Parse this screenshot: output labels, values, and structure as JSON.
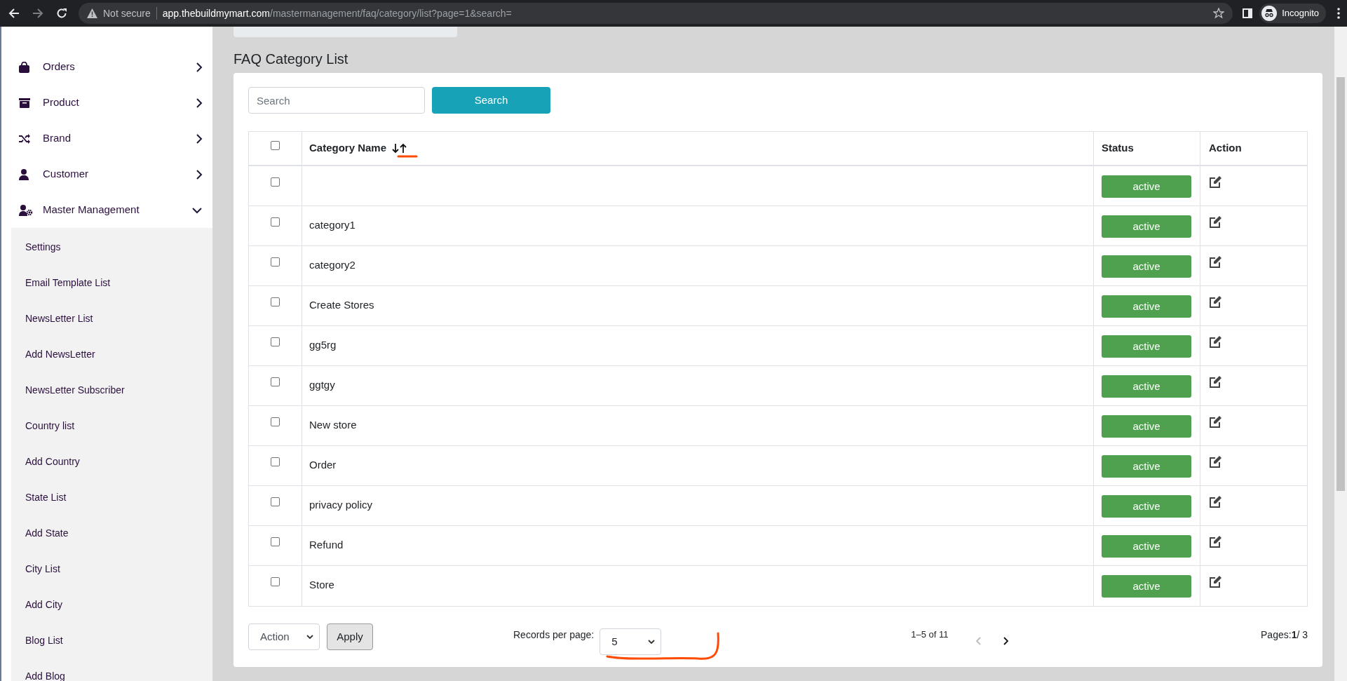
{
  "browser": {
    "security_label": "Not secure",
    "url_host": "app.thebuildmymart.com",
    "url_path": "/mastermanagement/faq/category/list?page=1&search=",
    "profile_label": "Incognito"
  },
  "sidebar": {
    "items": [
      {
        "label": "Orders",
        "expanded": false
      },
      {
        "label": "Product",
        "expanded": false
      },
      {
        "label": "Brand",
        "expanded": false
      },
      {
        "label": "Customer",
        "expanded": false
      },
      {
        "label": "Master Management",
        "expanded": true,
        "children": [
          {
            "label": "Settings"
          },
          {
            "label": "Email Template List"
          },
          {
            "label": "NewsLetter List"
          },
          {
            "label": "Add NewsLetter"
          },
          {
            "label": "NewsLetter Subscriber"
          },
          {
            "label": "Country list"
          },
          {
            "label": "Add Country"
          },
          {
            "label": "State List"
          },
          {
            "label": "Add State"
          },
          {
            "label": "City List"
          },
          {
            "label": "Add City"
          },
          {
            "label": "Blog List"
          },
          {
            "label": "Add Blog"
          }
        ]
      }
    ]
  },
  "page_title": "FAQ Category List",
  "search": {
    "placeholder": "Search",
    "button": "Search"
  },
  "table": {
    "select_all_checked": false,
    "columns": [
      "Category Name",
      "Status",
      "Action"
    ],
    "rows": [
      {
        "checked": false,
        "name": "",
        "status": "active"
      },
      {
        "checked": false,
        "name": "category1",
        "status": "active"
      },
      {
        "checked": false,
        "name": "category2",
        "status": "active"
      },
      {
        "checked": false,
        "name": "Create Stores",
        "status": "active"
      },
      {
        "checked": false,
        "name": "gg5rg",
        "status": "active"
      },
      {
        "checked": false,
        "name": "ggtgy",
        "status": "active"
      },
      {
        "checked": false,
        "name": "New store",
        "status": "active"
      },
      {
        "checked": false,
        "name": "Order",
        "status": "active"
      },
      {
        "checked": false,
        "name": "privacy policy",
        "status": "active"
      },
      {
        "checked": false,
        "name": "Refund",
        "status": "active"
      },
      {
        "checked": false,
        "name": "Store",
        "status": "active"
      }
    ]
  },
  "footer": {
    "action_select": "Action",
    "apply_button": "Apply",
    "records_label": "Records per page:",
    "records_per_page": "5",
    "range": "1–5 of 11",
    "prev_disabled": true,
    "next_disabled": false,
    "pages": "Pages:**1**/ 3"
  }
}
